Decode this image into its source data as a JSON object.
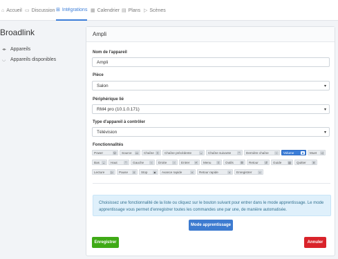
{
  "nav": {
    "tabs": [
      {
        "label": "Accueil",
        "icon": "home-icon",
        "glyph": "⌂"
      },
      {
        "label": "Discussion",
        "icon": "chat-icon",
        "glyph": "▭"
      },
      {
        "label": "Intégrations",
        "icon": "grid-icon",
        "glyph": "⊞"
      },
      {
        "label": "Calendrier",
        "icon": "calendar-icon",
        "glyph": "▦"
      },
      {
        "label": "Plans",
        "icon": "map-icon",
        "glyph": "▤"
      },
      {
        "label": "Scènes",
        "icon": "play-icon",
        "glyph": "▷"
      }
    ],
    "active_color": "#3b7dd8"
  },
  "sidebar": {
    "title": "Broadlink",
    "items": [
      {
        "label": "Appareils",
        "icon": "devices-icon",
        "glyph": "◂▸"
      },
      {
        "label": "Appareils disponibles",
        "icon": "wifi-icon",
        "glyph": "◡"
      }
    ]
  },
  "card": {
    "title": "Ampli",
    "fields": {
      "name_label": "Nom de l'appareil",
      "name_value": "Ampli",
      "room_label": "Pièce",
      "room_value": "Salon",
      "peripheral_label": "Périphérique lié",
      "peripheral_value": "RM4 pro (10.1.0.171)",
      "type_label": "Type d'appareil à contrôler",
      "type_value": "Télévision"
    },
    "functions_label": "Fonctionnalités",
    "functions": [
      {
        "label": "Power",
        "glyph": "⏻",
        "selected": false
      },
      {
        "label": "Source",
        "glyph": "▭",
        "selected": false
      },
      {
        "label": "Chaîne",
        "glyph": "≡",
        "selected": false
      },
      {
        "label": "Chaîne précédente",
        "glyph": "⌄",
        "selected": false
      },
      {
        "label": "Chaîne suivante",
        "glyph": "⌃",
        "selected": false
      },
      {
        "label": "Dernière chaîne",
        "glyph": "‹",
        "selected": false
      },
      {
        "label": "Volume",
        "glyph": "◆",
        "selected": true
      },
      {
        "label": "Muet",
        "glyph": "◁",
        "selected": false
      },
      {
        "label": "Bas",
        "glyph": "⌄",
        "selected": false
      },
      {
        "label": "Haut",
        "glyph": "⌃",
        "selected": false
      },
      {
        "label": "Gauche",
        "glyph": "‹",
        "selected": false
      },
      {
        "label": "Droite",
        "glyph": "›",
        "selected": false
      },
      {
        "label": "Entrer",
        "glyph": "↵",
        "selected": false
      },
      {
        "label": "Menu",
        "glyph": "≡",
        "selected": false
      },
      {
        "label": "Outils",
        "glyph": "⚙",
        "selected": false
      },
      {
        "label": "Retour",
        "glyph": "↺",
        "selected": false
      },
      {
        "label": "Guide",
        "glyph": "▤",
        "selected": false
      },
      {
        "label": "Quitter",
        "glyph": "✕",
        "selected": false
      },
      {
        "label": "Lecture",
        "glyph": "▷",
        "selected": false
      },
      {
        "label": "Pause",
        "glyph": "‖",
        "selected": false
      },
      {
        "label": "Stop",
        "glyph": "■",
        "selected": false
      },
      {
        "label": "Avance rapide",
        "glyph": "»",
        "selected": false
      },
      {
        "label": "Retour rapide",
        "glyph": "«",
        "selected": false
      },
      {
        "label": "Enregistrer",
        "glyph": "○",
        "selected": false
      }
    ],
    "info_text": "Choisissez une fonctionnalité de la liste ou cliquez sur le bouton suivant pour entrer dans le mode apprentissage. Le mode apprentissage vous permet d'enregistrer toutes les commandes une par une, de manière automatisée.",
    "learn_button": "Mode apprentissage",
    "save_button": "Enregistrer",
    "cancel_button": "Annuler"
  },
  "colors": {
    "primary": "#3d7bd0",
    "success": "#3faa16",
    "danger": "#d9232a",
    "info_bg": "#dff0fb"
  }
}
